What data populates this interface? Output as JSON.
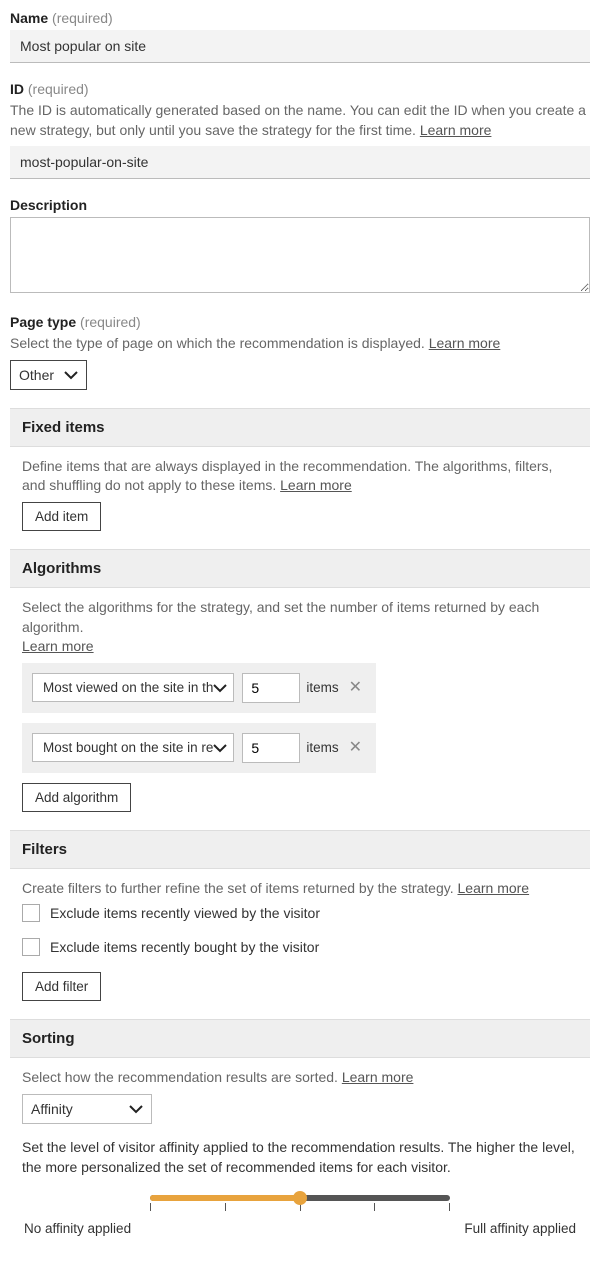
{
  "name": {
    "label": "Name",
    "required": "(required)",
    "value": "Most popular on site"
  },
  "id": {
    "label": "ID",
    "required": "(required)",
    "help": "The ID is automatically generated based on the name. You can edit the ID when you create a new strategy, but only until you save the strategy for the first time.",
    "learn_more": "Learn more",
    "value": "most-popular-on-site"
  },
  "description": {
    "label": "Description",
    "value": ""
  },
  "page_type": {
    "label": "Page type",
    "required": "(required)",
    "help": "Select the type of page on which the recommendation is displayed.",
    "learn_more": "Learn more",
    "value": "Other"
  },
  "fixed_items": {
    "title": "Fixed items",
    "help": "Define items that are always displayed in the recommendation. The algorithms, filters, and shuffling do not apply to these items.",
    "learn_more": "Learn more",
    "button": "Add item"
  },
  "algorithms": {
    "title": "Algorithms",
    "help": "Select the algorithms for the strategy, and set the number of items returned by each algorithm.",
    "learn_more": "Learn more",
    "rows": [
      {
        "name": "Most viewed on the site in the past",
        "count": "5",
        "unit": "items"
      },
      {
        "name": "Most bought on the site in recent",
        "count": "5",
        "unit": "items"
      }
    ],
    "button": "Add algorithm"
  },
  "filters": {
    "title": "Filters",
    "help": "Create filters to further refine the set of items returned by the strategy.",
    "learn_more": "Learn more",
    "options": [
      "Exclude items recently viewed by the visitor",
      "Exclude items recently bought by the visitor"
    ],
    "button": "Add filter"
  },
  "sorting": {
    "title": "Sorting",
    "help": "Select how the recommendation results are sorted.",
    "learn_more": "Learn more",
    "value": "Affinity",
    "affinity_help": "Set the level of visitor affinity applied to the recommendation results. The higher the level, the more personalized the set of recommended items for each visitor.",
    "min_label": "No affinity applied",
    "max_label": "Full affinity applied"
  }
}
